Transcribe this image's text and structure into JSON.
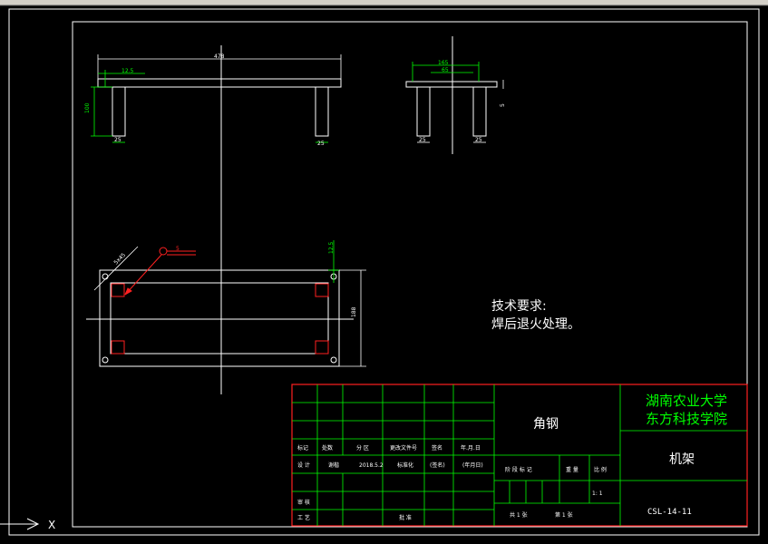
{
  "drawing": {
    "top_view": {
      "overall_length": "478",
      "flange": "12.5",
      "height": "100",
      "leg_width_left": "25",
      "leg_width_right": "25"
    },
    "side_view": {
      "outer_width": "165",
      "inner_width": "65",
      "thickness": "5",
      "leg_width_left": "25",
      "leg_width_right": "25"
    },
    "plan_view": {
      "angle_note": "5x45",
      "weld_note": "5",
      "corner_dim": "12.5",
      "height": "188"
    },
    "technical_requirements": {
      "heading": "技术要求:",
      "line1": "焊后退火处理。"
    },
    "title_block": {
      "material": "角钢",
      "school_line1": "湖南农业大学",
      "school_line2": "东方科技学院",
      "part_name": "机架",
      "drawing_no": "CSL-14-11",
      "label_mark": "标记",
      "label_count": "处数",
      "label_zone": "分 区",
      "label_change_doc": "更改文件号",
      "label_sign": "签名",
      "label_date": "年.月.日",
      "label_design": "设 计",
      "value_design_name": "谢楷",
      "value_design_date": "2018.5.2",
      "label_standardize": "标准化",
      "label_sign2": "(签名)",
      "label_date2": "(年月日)",
      "label_stage": "阶 段 标 记",
      "label_weight": "重 量",
      "label_scale": "比 例",
      "value_scale": "1: 1",
      "label_review": "审 核",
      "label_process": "工 艺",
      "label_approve": "批 准",
      "label_sheets": "共 1 张",
      "label_sheet_no": "第 1 张"
    },
    "axis_marker": "X"
  }
}
